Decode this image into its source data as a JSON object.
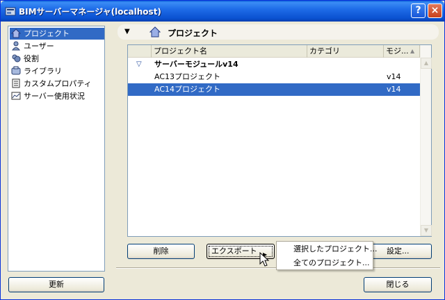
{
  "window": {
    "title": "BIMサーバーマネージャ(localhost)",
    "help_label": "?",
    "close_label": "×"
  },
  "sidebar": {
    "items": [
      {
        "label": "プロジェクト",
        "icon": "house-icon",
        "selected": true
      },
      {
        "label": "ユーザー",
        "icon": "user-icon",
        "selected": false
      },
      {
        "label": "役割",
        "icon": "role-icon",
        "selected": false
      },
      {
        "label": "ライブラリ",
        "icon": "library-icon",
        "selected": false
      },
      {
        "label": "カスタムプロパティ",
        "icon": "properties-icon",
        "selected": false
      },
      {
        "label": "サーバー使用状況",
        "icon": "chart-icon",
        "selected": false
      }
    ],
    "update_label": "更新"
  },
  "panel": {
    "title": "プロジェクト",
    "collapse_glyph": "▼"
  },
  "table": {
    "columns": [
      "プロジェクト名",
      "カテゴリ",
      "モジ..."
    ],
    "group": {
      "label": "サーバーモジュールv14",
      "glyph": "▽"
    },
    "rows": [
      {
        "name": "AC13プロジェクト",
        "category": "",
        "module": "v14",
        "selected": false
      },
      {
        "name": "AC14プロジェクト",
        "category": "",
        "module": "v14",
        "selected": true
      }
    ],
    "sort_glyph": "▲"
  },
  "buttons": {
    "delete": "削除",
    "export": "エクスポート",
    "settings": "設定...",
    "close": "閉じる"
  },
  "context_menu": {
    "items": [
      "選択したプロジェクト...",
      "全てのプロジェクト..."
    ]
  },
  "colors": {
    "selection": "#316ac5",
    "titlebar": "#0a51d0",
    "window_bg": "#ece9d8"
  }
}
